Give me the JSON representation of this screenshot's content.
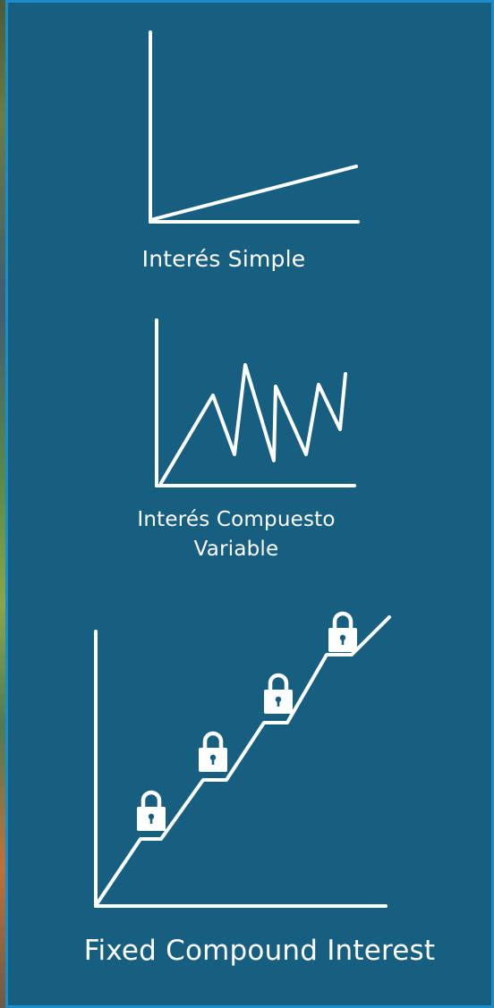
{
  "diagrams": [
    {
      "id": "simple",
      "caption_lines": [
        "Interés Simple"
      ],
      "icon": "line-graph-icon"
    },
    {
      "id": "variable",
      "caption_lines": [
        "Interés Compuesto",
        "Variable"
      ],
      "icon": "zigzag-graph-icon"
    },
    {
      "id": "fixed",
      "caption_lines": [
        "Fixed Compound Interest"
      ],
      "icon": "stepped-graph-icon",
      "lock_icon": "padlock-icon",
      "lock_count": 4
    }
  ],
  "colors": {
    "panel": "#175f81",
    "border": "#1b8ec9",
    "line": "#ffffff"
  }
}
